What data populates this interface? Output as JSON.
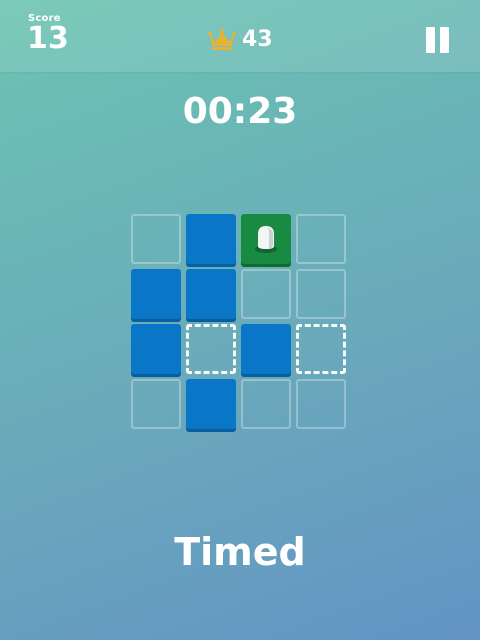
{
  "hud": {
    "score_label": "Score",
    "score": "13",
    "best": "43",
    "crown_color": "#e6b23a"
  },
  "timer": "00:23",
  "mode": "Timed",
  "colors": {
    "tile_blue": "#0a76c8",
    "tile_player": "#188a42",
    "background_top": "#6bc4b2",
    "background_bottom": "#6394c4"
  },
  "board": {
    "rows": 4,
    "cols": 4,
    "cells": [
      [
        "empty",
        "blue",
        "player",
        "empty"
      ],
      [
        "blue",
        "blue",
        "empty",
        "empty"
      ],
      [
        "blue",
        "goal",
        "blue",
        "goal"
      ],
      [
        "empty",
        "blue",
        "empty",
        "empty"
      ]
    ]
  }
}
